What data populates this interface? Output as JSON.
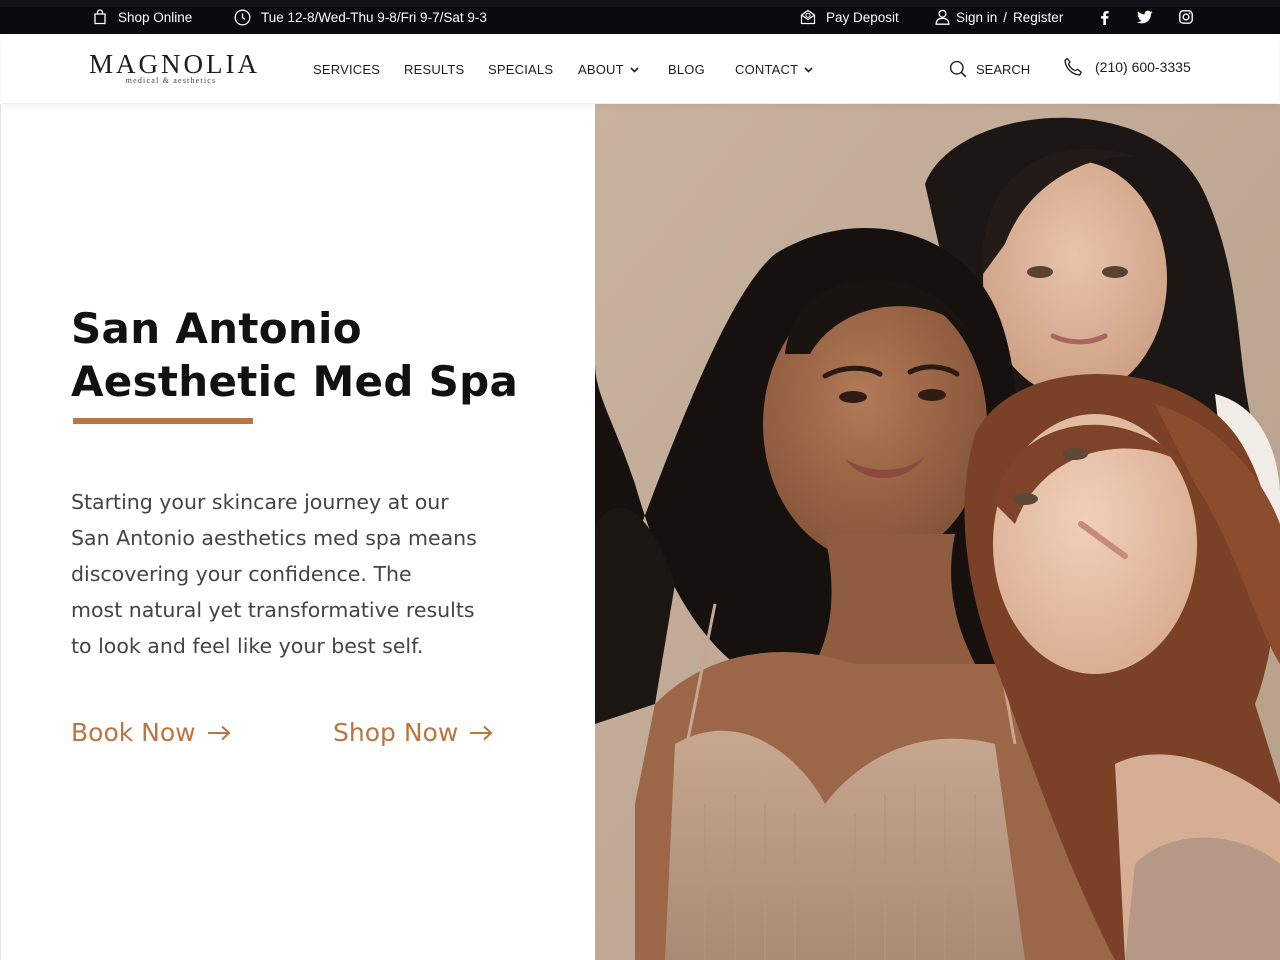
{
  "topbar": {
    "shop_label": "Shop Online",
    "hours": "Tue 12-8/Wed-Thu 9-8/Fri 9-7/Sat 9-3",
    "deposit_label": "Pay Deposit",
    "sign_in": "Sign in",
    "separator": "/",
    "register": "Register",
    "social_icons": [
      "facebook-icon",
      "twitter-icon",
      "instagram-icon"
    ]
  },
  "header": {
    "logo_main": "MAGNOLIA",
    "logo_sub": "medical & aesthetics",
    "nav": [
      {
        "label": "SERVICES",
        "has_dropdown": false
      },
      {
        "label": "RESULTS",
        "has_dropdown": false
      },
      {
        "label": "SPECIALS",
        "has_dropdown": false
      },
      {
        "label": "ABOUT",
        "has_dropdown": true
      },
      {
        "label": "BLOG",
        "has_dropdown": false
      },
      {
        "label": "CONTACT",
        "has_dropdown": true
      }
    ],
    "search_label": "SEARCH",
    "phone": "(210) 600-3335"
  },
  "hero": {
    "title_line1": "San Antonio",
    "title_line2": "Aesthetic Med Spa",
    "body_lines": [
      "Starting your skincare journey at our",
      "San Antonio aesthetics med spa means",
      "discovering your confidence. The",
      "most natural yet transformative results",
      "to look and feel like your best self."
    ],
    "book_label": "Book Now",
    "shop_label": "Shop Now",
    "image": "three-women-portrait"
  },
  "colors": {
    "topbar_bg": "#0b0b0f",
    "accent": "#b97542",
    "text_dark": "#111111",
    "text_body": "#444444",
    "image_backdrop": "#c6b19c"
  }
}
